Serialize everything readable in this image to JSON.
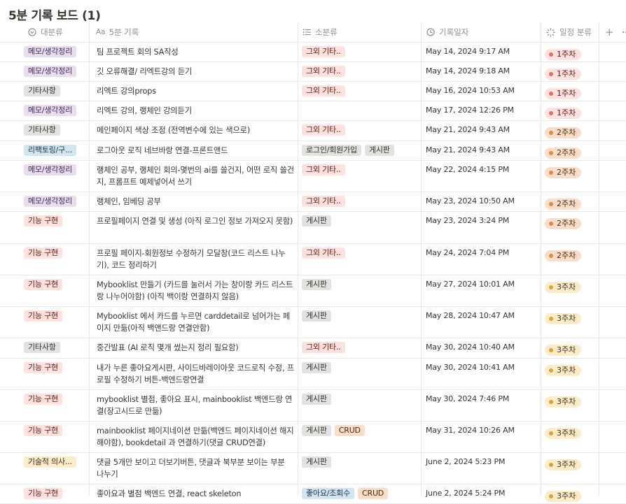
{
  "title": "5분 기록 보드 (1)",
  "columns": {
    "category": "대분류",
    "name": "5분 기록",
    "subcategory": "소분류",
    "date": "기록일자",
    "week": "일정 분류",
    "add": "+"
  },
  "rows": [
    {
      "category": "메모/생각정리",
      "cat_color": "purple",
      "name": "팀 프로젝트 회의 SA작성",
      "tags": [
        {
          "label": "그외 기타..",
          "color": "red"
        }
      ],
      "date": "May 14, 2024 9:17 AM",
      "week": "1주차",
      "wk": "1"
    },
    {
      "category": "메모/생각정리",
      "cat_color": "purple",
      "name": "깃 오류해결/ 리엑트강의 듣기",
      "tags": [
        {
          "label": "그외 기타..",
          "color": "red"
        }
      ],
      "date": "May 14, 2024 9:18 AM",
      "week": "1주차",
      "wk": "1"
    },
    {
      "category": "기타사항",
      "cat_color": "gray",
      "name": "리엑트 강의props",
      "tags": [
        {
          "label": "그외 기타..",
          "color": "red"
        }
      ],
      "date": "May 16, 2024 10:53 AM",
      "week": "1주차",
      "wk": "1"
    },
    {
      "category": "메모/생각정리",
      "cat_color": "purple",
      "name": "리엑트 강의, 랭체인 강의듣기",
      "tags": [],
      "date": "May 17, 2024 12:26 PM",
      "week": "1주차",
      "wk": "1"
    },
    {
      "category": "기타사항",
      "cat_color": "gray",
      "name": "메인페이지 색상 조정 (전역변수에 있는 색으로)",
      "tags": [
        {
          "label": "그외 기타..",
          "color": "red"
        }
      ],
      "date": "May 21, 2024 9:43 AM",
      "week": "2주차",
      "wk": "2"
    },
    {
      "category": "리팩토링/구...",
      "cat_color": "blue",
      "name": "로그아웃 로직 네브바랑 연결-프론트앤드",
      "tags": [
        {
          "label": "로그인/회원가입",
          "color": "gray"
        },
        {
          "label": "게시판",
          "color": "gray"
        }
      ],
      "date": "May 21, 2024 9:43 AM",
      "week": "2주차",
      "wk": "2"
    },
    {
      "category": "메모/생각정리",
      "cat_color": "purple",
      "name": "랭체인 공부, 랭체인 회의-몇번의 ai를 쓸건지, 어떤 로직 쓸건지, 프롬프트 예제넣어서 쓰기",
      "tags": [
        {
          "label": "그외 기타..",
          "color": "red"
        }
      ],
      "date": "May 22, 2024 4:15 PM",
      "week": "2주차",
      "wk": "2"
    },
    {
      "category": "메모/생각정리",
      "cat_color": "purple",
      "name": "랭체인, 임베딩 공부",
      "tags": [
        {
          "label": "그외 기타..",
          "color": "red"
        }
      ],
      "date": "May 23, 2024 10:50 AM",
      "week": "2주차",
      "wk": "2"
    },
    {
      "category": "기능 구현",
      "cat_color": "red",
      "name": "프로필페이지 연결 및 생성 (아직 로그인 정보 가져오지 못함)",
      "tags": [
        {
          "label": "게시판",
          "color": "gray"
        }
      ],
      "date": "May 23, 2024 3:24 PM",
      "week": "2주차",
      "wk": "2"
    },
    {
      "category": "기능 구현",
      "cat_color": "red",
      "name": "프로필 페이지-회원정보 수정하기 모달창(코드 리스트 나누기), 코드 정리하기",
      "tags": [
        {
          "label": "그외 기타..",
          "color": "red"
        }
      ],
      "date": "May 24, 2024 7:04 PM",
      "week": "2주차",
      "wk": "2"
    },
    {
      "category": "기능 구현",
      "cat_color": "red",
      "name": "Mybooklist 만들기 (카드를 눌러서 가는 창이랑 카드 리스트랑 나누어야함) (아직 백이랑 연결하지 않음)",
      "tags": [
        {
          "label": "게시판",
          "color": "gray"
        }
      ],
      "date": "May 27, 2024 10:01 AM",
      "week": "3주차",
      "wk": "3"
    },
    {
      "category": "기능 구현",
      "cat_color": "red",
      "name": "Mybooklist 에서 카드를 누르면 carddetail로 넘어가는 페이지 만듦(아직 백앤드랑 연결안함)",
      "tags": [
        {
          "label": "게시판",
          "color": "gray"
        }
      ],
      "date": "May 28, 2024 10:47 AM",
      "week": "3주차",
      "wk": "3"
    },
    {
      "category": "기타사항",
      "cat_color": "gray",
      "name": "중간발표 (AI 로직 몇개 썼는지 정리 필요함)",
      "tags": [
        {
          "label": "그외 기타..",
          "color": "red"
        }
      ],
      "date": "May 30, 2024 10:40 AM",
      "week": "3주차",
      "wk": "3"
    },
    {
      "category": "기능 구현",
      "cat_color": "red",
      "name": "내가 누른 좋아요게시판, 사이드바레이아웃 코드로직 수정, 프로필 수정하기 버튼-백엔드랑연결",
      "tags": [
        {
          "label": "게시판",
          "color": "gray"
        }
      ],
      "date": "May 30, 2024 10:41 AM",
      "week": "3주차",
      "wk": "3"
    },
    {
      "category": "기능 구현",
      "cat_color": "red",
      "name": "mybooklist 별점, 좋아요 표시, mainbooklist 백엔드랑 연결(장고시드로 만듦)",
      "tags": [
        {
          "label": "게시판",
          "color": "gray"
        }
      ],
      "date": "May 30, 2024 7:46 PM",
      "week": "3주차",
      "wk": "3"
    },
    {
      "category": "기능 구현",
      "cat_color": "red",
      "name": "mainbooklist 페이지네이션 만듦(백엔드 페이지네이션 해지해야함), bookdetail 과 연결하기(댓글 CRUD연결)",
      "tags": [
        {
          "label": "게시판",
          "color": "gray"
        },
        {
          "label": "CRUD",
          "color": "orange"
        }
      ],
      "date": "May 31, 2024 10:26 AM",
      "week": "3주차",
      "wk": "3"
    },
    {
      "category": "기술적 의사...",
      "cat_color": "yellow",
      "name": "댓글 5개만 보이고 더보기버튼, 댓글과 북부분 보이는 부분 나누기",
      "tags": [
        {
          "label": "게시판",
          "color": "gray"
        }
      ],
      "date": "June 2, 2024 5:23 PM",
      "week": "3주차",
      "wk": "3"
    },
    {
      "category": "기능 구현",
      "cat_color": "red",
      "name": "좋아요과 별점 백엔드 연결, react skeleton",
      "tags": [
        {
          "label": "좋아요/조회수",
          "color": "blue"
        },
        {
          "label": "CRUD",
          "color": "orange"
        }
      ],
      "date": "June 2, 2024 5:24 PM",
      "week": "3주차",
      "wk": "3"
    }
  ]
}
